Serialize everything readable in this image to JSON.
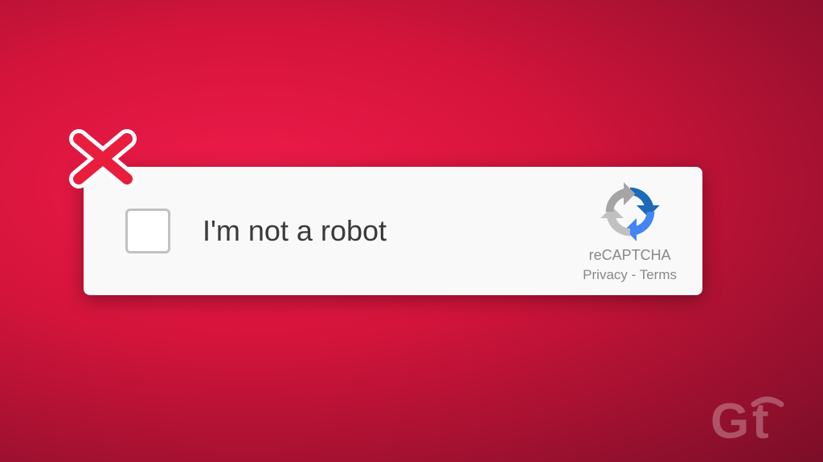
{
  "recaptcha": {
    "label": "I'm not a robot",
    "brand": "reCAPTCHA",
    "privacy": "Privacy",
    "separator": " - ",
    "terms": "Terms"
  },
  "watermark": {
    "text": "Gt"
  }
}
